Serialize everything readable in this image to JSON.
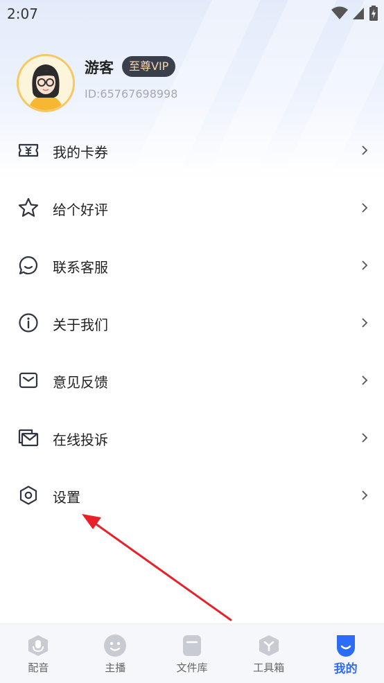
{
  "status_bar": {
    "time": "2:07"
  },
  "profile": {
    "name": "游客",
    "vip_label": "至尊VIP",
    "user_id": "ID:65767698998"
  },
  "menu": {
    "items": [
      {
        "label": "我的卡券",
        "icon": "ticket-icon"
      },
      {
        "label": "给个好评",
        "icon": "star-icon"
      },
      {
        "label": "联系客服",
        "icon": "chat-icon"
      },
      {
        "label": "关于我们",
        "icon": "info-icon"
      },
      {
        "label": "意见反馈",
        "icon": "mail-icon"
      },
      {
        "label": "在线投诉",
        "icon": "complaint-icon"
      },
      {
        "label": "设置",
        "icon": "settings-icon"
      }
    ]
  },
  "tabbar": {
    "items": [
      {
        "label": "配音",
        "icon": "mic-icon",
        "active": false
      },
      {
        "label": "主播",
        "icon": "face-icon",
        "active": false
      },
      {
        "label": "文件库",
        "icon": "file-icon",
        "active": false
      },
      {
        "label": "工具箱",
        "icon": "toolbox-icon",
        "active": false
      },
      {
        "label": "我的",
        "icon": "profile-icon",
        "active": true
      }
    ]
  },
  "colors": {
    "accent": "#2d6cf6",
    "vip_bg": "#3b3f4c",
    "vip_text": "#f3d7a8",
    "arrow": "#e8202a",
    "icon": "#2f3440"
  }
}
